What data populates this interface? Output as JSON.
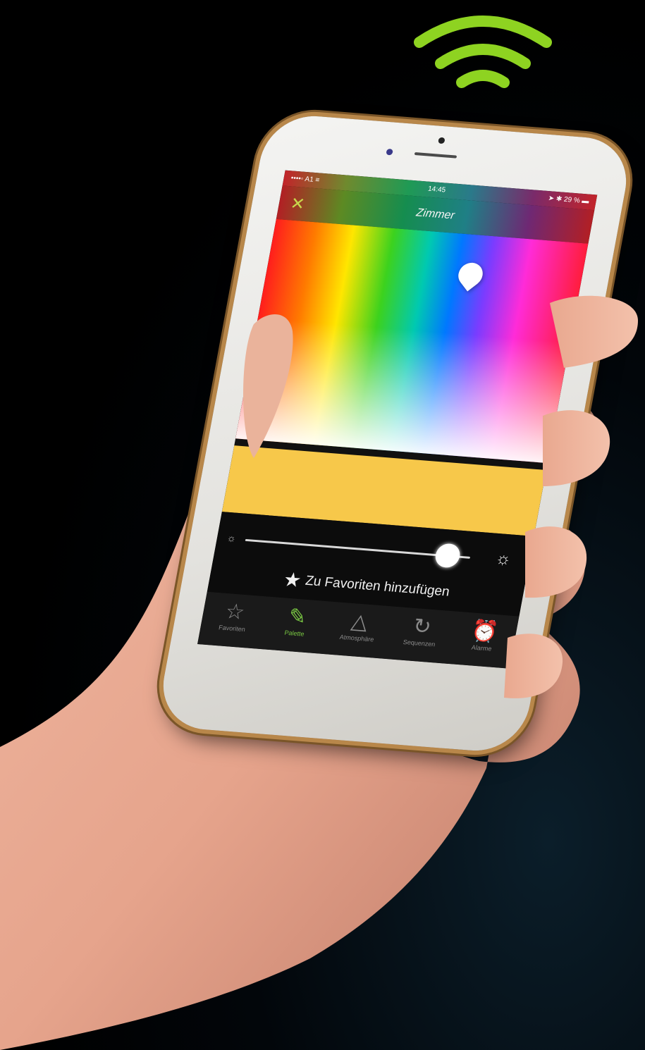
{
  "colors": {
    "wifi": "#8ed321",
    "accent": "#7ac943",
    "selected_color": "#f7c84a",
    "phone_frame": "#b8874a"
  },
  "statusbar": {
    "carrier": "••••◦ A1 ≡",
    "time": "14:45",
    "battery": "➤ ✱ 29 % ▬"
  },
  "navbar": {
    "close_icon": "close-icon",
    "title": "Zimmer"
  },
  "brightness": {
    "level": 0.9,
    "low_icon": "sun-small-icon",
    "high_icon": "sun-large-icon"
  },
  "favorites": {
    "label": "Zu Favoriten hinzufügen"
  },
  "tabs": [
    {
      "label": "Favoriten",
      "icon": "star-outline-icon",
      "active": false
    },
    {
      "label": "Palette",
      "icon": "eyedropper-icon",
      "active": true
    },
    {
      "label": "Atmosphäre",
      "icon": "mountain-icon",
      "active": false
    },
    {
      "label": "Sequenzen",
      "icon": "refresh-cycle-icon",
      "active": false
    },
    {
      "label": "Alarme",
      "icon": "alarm-clock-icon",
      "active": false
    }
  ]
}
